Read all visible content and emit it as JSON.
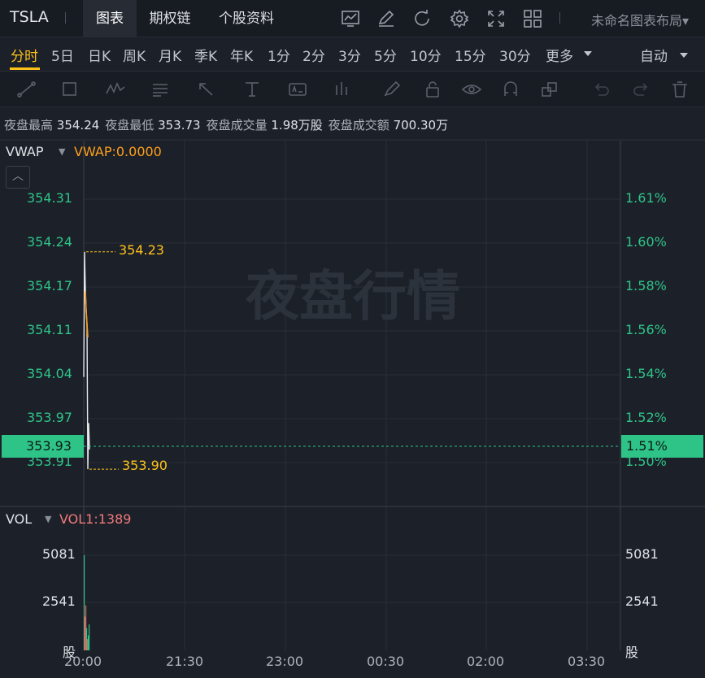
{
  "header": {
    "symbol": "TSLA",
    "tabs": [
      {
        "label": "图表",
        "active": true
      },
      {
        "label": "期权链",
        "active": false
      },
      {
        "label": "个股资料",
        "active": false
      }
    ],
    "toolbar_icons": [
      "chart-icon",
      "draw-pen-icon",
      "refresh-icon",
      "settings-gear-icon",
      "fullscreen-icon",
      "layout-grid-icon"
    ],
    "layout_label": "未命名图表布局"
  },
  "periods": {
    "items": [
      "分时",
      "5日",
      "日K",
      "周K",
      "月K",
      "季K",
      "年K",
      "1分",
      "2分",
      "3分",
      "5分",
      "10分",
      "15分",
      "30分",
      "更多"
    ],
    "active": "分时",
    "adjust_label": "自动"
  },
  "drawing_tools": [
    "trend-line-icon",
    "rectangle-icon",
    "wave-icon",
    "fibonacci-icon",
    "arrow-icon",
    "text-cursor-icon",
    "text-box-icon",
    "bar-marker-icon",
    "brush-icon",
    "lock-icon",
    "eye-icon",
    "magnet-icon",
    "layers-icon",
    "undo-icon",
    "redo-icon",
    "trash-icon"
  ],
  "stats": [
    {
      "label": "夜盘最高",
      "value": "354.24"
    },
    {
      "label": "夜盘最低",
      "value": "353.73"
    },
    {
      "label": "夜盘成交量",
      "value": "1.98万股"
    },
    {
      "label": "夜盘成交额",
      "value": "700.30万"
    }
  ],
  "price_panel": {
    "indicator_name": "VWAP",
    "indicator_value": "VWAP:0.0000",
    "watermark": "夜盘行情",
    "price_ticks": [
      "354.31",
      "354.24",
      "354.17",
      "354.11",
      "354.04",
      "353.97",
      "353.91"
    ],
    "pct_ticks": [
      "1.61%",
      "1.60%",
      "1.58%",
      "1.56%",
      "1.54%",
      "1.52%",
      "1.50%"
    ],
    "current_price": "353.93",
    "current_pct": "1.51%",
    "high_label": "354.23",
    "low_label": "353.90"
  },
  "volume_panel": {
    "indicator_name": "VOL",
    "indicator_value": "VOL1:1389",
    "ticks": [
      "5081",
      "2541"
    ],
    "unit": "股"
  },
  "time_axis": [
    "20:00",
    "21:30",
    "23:00",
    "00:30",
    "02:00",
    "03:30"
  ],
  "colors": {
    "up": "#2ec488",
    "down": "#f05a5a",
    "accent": "#ffc21a",
    "vwap": "#ff9f1a",
    "bg": "#1c2029"
  },
  "chart_data": {
    "type": "line",
    "series": [
      {
        "values": [
          354.04,
          354.23,
          354.17,
          354.14,
          354.12,
          353.9,
          353.97,
          353.93
        ]
      }
    ],
    "ylim": [
      353.9,
      354.33
    ],
    "volume": [
      5081,
      1800,
      2400,
      1200,
      600,
      800,
      1389
    ]
  }
}
